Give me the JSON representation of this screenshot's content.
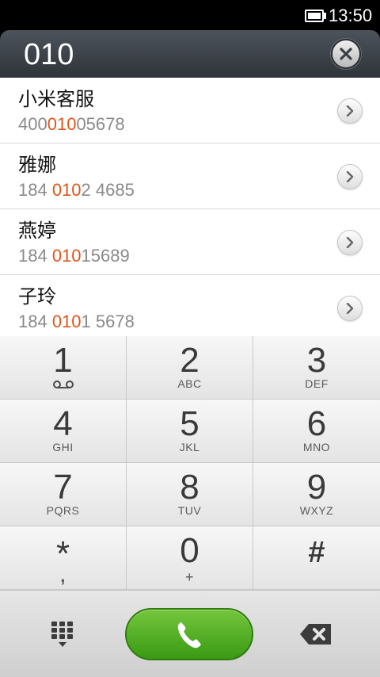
{
  "status_bar": {
    "time": "13:50",
    "battery_icon": "battery-full-icon"
  },
  "dialer": {
    "dialed_number": "010",
    "clear_icon": "close-icon"
  },
  "contacts": [
    {
      "name": "小米客服",
      "number_pre": "400",
      "number_match": "010",
      "number_post": "05678"
    },
    {
      "name": "雅娜",
      "number_pre": "184 ",
      "number_match": "010",
      "number_post": "2 4685"
    },
    {
      "name": "燕婷",
      "number_pre": "184 ",
      "number_match": "010",
      "number_post": "15689"
    },
    {
      "name": "子玲",
      "number_pre": "184 ",
      "number_match": "010",
      "number_post": "1 5678"
    }
  ],
  "keypad": [
    {
      "digit": "1",
      "letters": ""
    },
    {
      "digit": "2",
      "letters": "ABC"
    },
    {
      "digit": "3",
      "letters": "DEF"
    },
    {
      "digit": "4",
      "letters": "GHI"
    },
    {
      "digit": "5",
      "letters": "JKL"
    },
    {
      "digit": "6",
      "letters": "MNO"
    },
    {
      "digit": "7",
      "letters": "PQRS"
    },
    {
      "digit": "8",
      "letters": "TUV"
    },
    {
      "digit": "9",
      "letters": "WXYZ"
    },
    {
      "digit": "*",
      "letters": ","
    },
    {
      "digit": "0",
      "letters": "+"
    },
    {
      "digit": "#",
      "letters": ""
    }
  ],
  "bottom_bar": {
    "keypad_icon": "dialpad-icon",
    "call_icon": "phone-icon",
    "backspace_icon": "backspace-icon"
  },
  "colors": {
    "highlight": "#e2551a",
    "call_green": "#4caf1f",
    "header_dark": "#3a3f45"
  }
}
